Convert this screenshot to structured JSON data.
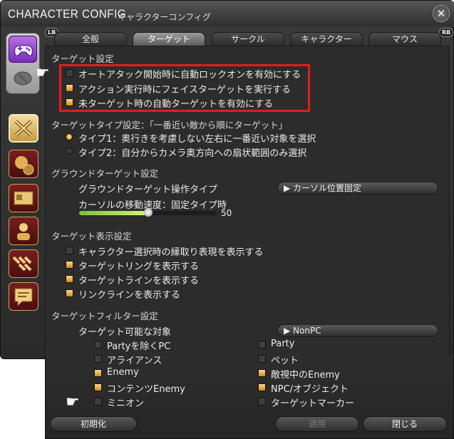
{
  "window": {
    "title_en": "CHARACTER CONFIG",
    "title_jp": "キャラクターコンフィグ",
    "close_glyph": "✕",
    "lb_label": "LB",
    "rb_label": "RB"
  },
  "tabs": [
    {
      "label": "全般",
      "active": false
    },
    {
      "label": "ターゲット",
      "active": true
    },
    {
      "label": "サークル",
      "active": false
    },
    {
      "label": "キャラクター",
      "active": false
    },
    {
      "label": "マウス",
      "active": false
    }
  ],
  "sidebar": {
    "items": [
      "gamepad-icon",
      "mouse-icon",
      "crossed-swords-icon",
      "money-bag-gear-icon",
      "id-card-icon",
      "character-icon",
      "party-icon",
      "chat-icon"
    ]
  },
  "target_settings": {
    "heading": "ターゲット設定",
    "options": [
      {
        "label": "オートアタック開始時に自動ロックオンを有効にする",
        "checked": false
      },
      {
        "label": "アクション実行時にフェイスターゲットを実行する",
        "checked": true
      },
      {
        "label": "未ターゲット時の自動ターゲットを有効にする",
        "checked": true
      }
    ]
  },
  "target_type": {
    "heading": "ターゲットタイプ設定：「一番近い敵から順にターゲット」",
    "options": [
      {
        "label": "タイプ1：奥行きを考慮しない左右に一番近い対象を選択",
        "selected": true
      },
      {
        "label": "タイプ2：自分からカメラ奥方向への扇状範囲のみ選択",
        "selected": false
      }
    ]
  },
  "ground_target": {
    "heading": "グラウンドターゲット設定",
    "op_type_label": "グラウンドターゲット操作タイプ",
    "op_type_value": "▶ カーソル位置固定",
    "cursor_speed_label": "カーソルの移動速度：固定タイプ時",
    "cursor_speed_value": "50",
    "cursor_speed_fraction": 0.5
  },
  "target_display": {
    "heading": "ターゲット表示設定",
    "options": [
      {
        "label": "キャラクター選択時の縁取り表現を表示する",
        "checked": false
      },
      {
        "label": "ターゲットリングを表示する",
        "checked": true
      },
      {
        "label": "ターゲットラインを表示する",
        "checked": true
      },
      {
        "label": "リンクラインを表示する",
        "checked": true
      }
    ]
  },
  "target_filter": {
    "heading": "ターゲットフィルター設定",
    "targetable_label": "ターゲット可能な対象",
    "targetable_value": "▶ NonPC",
    "left": [
      {
        "label": "Partyを除くPC",
        "checked": false
      },
      {
        "label": "アライアンス",
        "checked": false
      },
      {
        "label": "Enemy",
        "checked": true
      },
      {
        "label": "コンテンツEnemy",
        "checked": true
      },
      {
        "label": "ミニオン",
        "checked": false
      }
    ],
    "right": [
      {
        "label": "Party",
        "checked": false
      },
      {
        "label": "ペット",
        "checked": false
      },
      {
        "label": "敵視中のEnemy",
        "checked": true
      },
      {
        "label": "NPC/オブジェクト",
        "checked": true
      },
      {
        "label": "ターゲットマーカー",
        "checked": false
      }
    ]
  },
  "footer": {
    "reset_label": "初期化",
    "apply_label": "適用",
    "close_label": "閉じる"
  },
  "colors": {
    "highlight_box": "#e41d1d",
    "checkbox_on": "#e8a020",
    "slider_fill": "#a6dc52"
  }
}
